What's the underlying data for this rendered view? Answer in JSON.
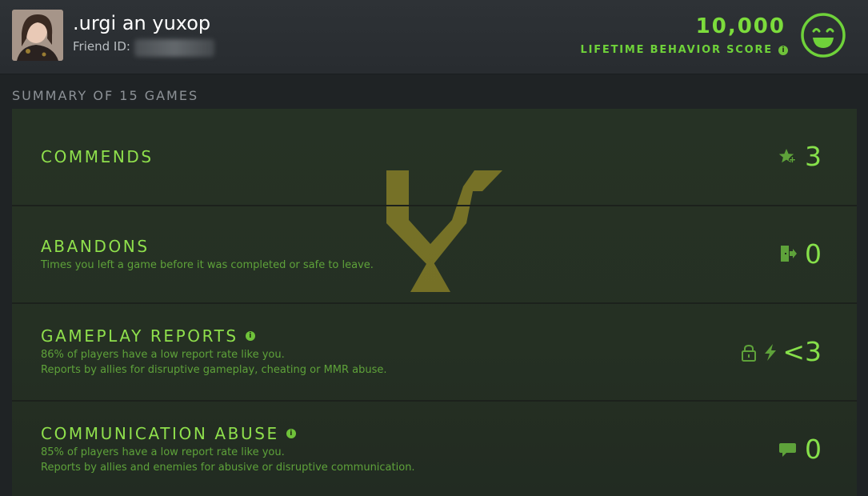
{
  "player": {
    "name": ".urgi an yuxop",
    "friend_id_label": "Friend ID:"
  },
  "behavior": {
    "score": "10,000",
    "label": "LIFETIME BEHAVIOR SCORE",
    "info_glyph": "i",
    "face_icon": "smiley-face-icon"
  },
  "summary": {
    "title": "SUMMARY OF 15 GAMES"
  },
  "rows": [
    {
      "title": "COMMENDS",
      "lines": [],
      "icon": "star-plus-icon",
      "value": "3"
    },
    {
      "title": "ABANDONS",
      "lines": [
        "Times you left a game before it was completed or safe to leave."
      ],
      "icon": "exit-door-icon",
      "value": "0"
    },
    {
      "title": "GAMEPLAY REPORTS",
      "info_glyph": "i",
      "lines": [
        "86% of players have a low report rate like you.",
        "Reports by allies for disruptive gameplay, cheating or MMR abuse."
      ],
      "icons": [
        "lock-icon",
        "lightning-icon"
      ],
      "value": "<3"
    },
    {
      "title": "COMMUNICATION ABUSE",
      "info_glyph": "i",
      "lines": [
        "85% of players have a low report rate like you.",
        "Reports by allies and enemies for abusive or disruptive communication."
      ],
      "icon": "chat-bubble-icon",
      "value": "0"
    }
  ],
  "colors": {
    "accent_green": "#7cdc3c",
    "desc_green": "#5ea23a",
    "watermark_gold": "#b8a62a"
  }
}
